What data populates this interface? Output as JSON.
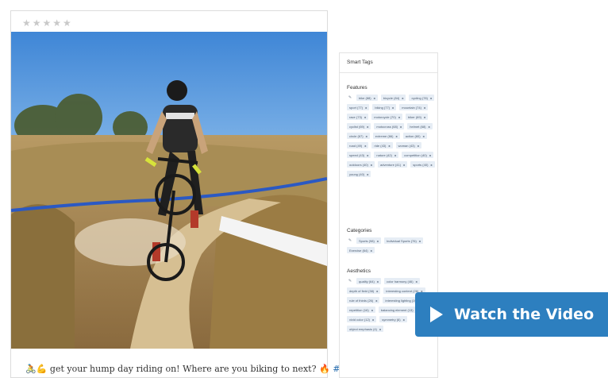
{
  "post": {
    "rating": "★★★★★",
    "caption_emoji": "🚴💪",
    "caption_text": " get your hump day riding on! Where are you biking to next? ",
    "caption_fire": "🔥",
    "hashtag": "#upzy",
    "caption_end": "."
  },
  "smart_tags": {
    "title": "Smart Tags",
    "sections": [
      {
        "title": "Features",
        "tags": [
          "bike (88)",
          "bicycle (84)",
          "cycling (78)",
          "sport (77)",
          "biking (77)",
          "mountain (74)",
          "race (73)",
          "motorcycle (70)",
          "biker (69)",
          "cyclist (69)",
          "motocross (68)",
          "helmet (68)",
          "circle (67)",
          "extreme (66)",
          "action (60)",
          "road (49)",
          "ride (43)",
          "woman (43)",
          "speed (43)",
          "nature (42)",
          "competition (40)",
          "outdoors (40)",
          "adventure (41)",
          "sports (40)",
          "young (40)"
        ]
      },
      {
        "title": "Categories",
        "tags": [
          "Sports (98)",
          "Individual Sports (76)",
          "Exercise (64)"
        ]
      },
      {
        "title": "Aesthetics",
        "tags": [
          "quality (64)",
          "color harmony (46)",
          "depth of field (38)",
          "interesting content (26)",
          "rule of thirds (26)",
          "interesting lighting (19)",
          "repetition (16)",
          "balancing element (13)",
          "vivid color (12)",
          "symmetry (6)",
          "object emphasis (4)"
        ]
      }
    ],
    "tag_icon": "tag-icon",
    "remove_symbol": "x"
  },
  "cta": {
    "label": "Watch the Video",
    "icon": "play-icon",
    "color": "#2d7fbf"
  }
}
